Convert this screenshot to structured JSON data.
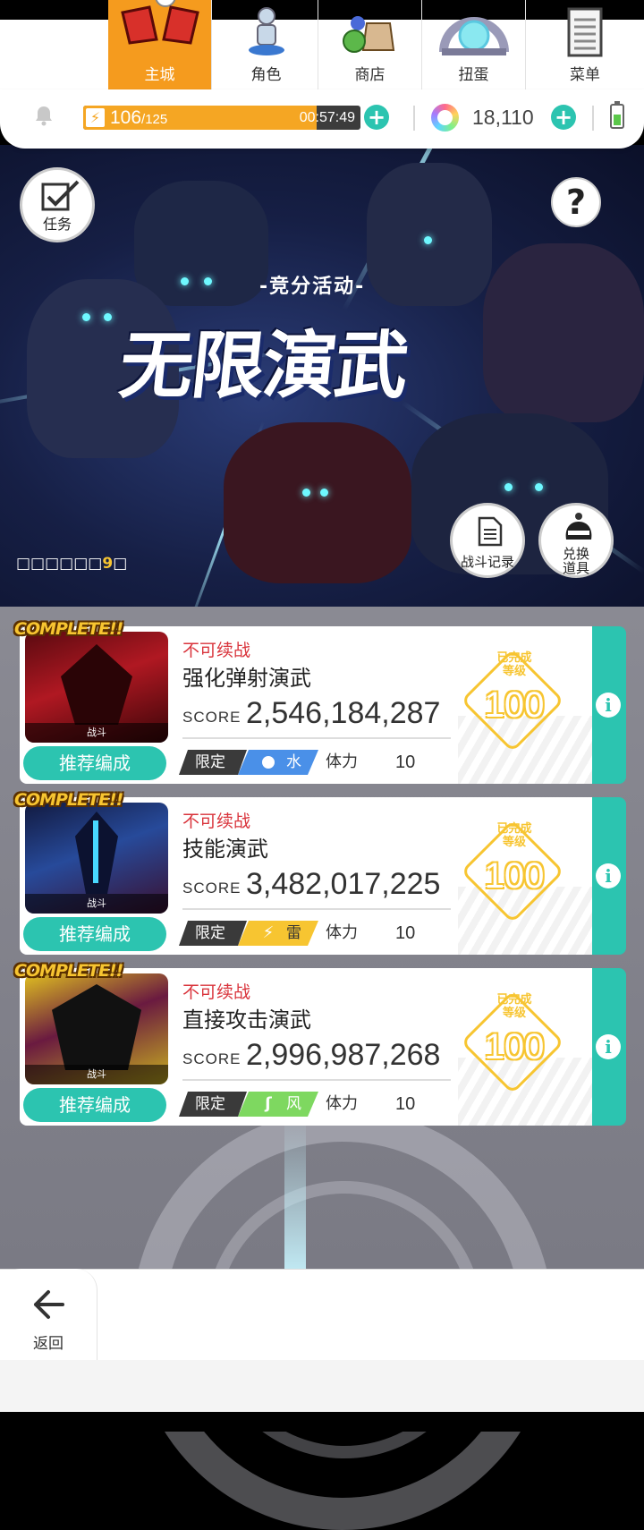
{
  "resources": {
    "stamina_current": "106",
    "stamina_max": "/125",
    "stamina_fraction": 0.843,
    "stamina_timer": "00:57:49",
    "gems": "18,110"
  },
  "event": {
    "tasks_label": "任务",
    "tag": "-竞分活动-",
    "title": "无限演武",
    "remain_prefix": "□□□□□□",
    "remain_number": "9",
    "remain_suffix": "□",
    "battle_log_label": "战斗记录",
    "exchange_label_1": "兑换",
    "exchange_label_2": "道具"
  },
  "cards": [
    {
      "complete": "COMPLETE!!",
      "thumb_label": "战斗",
      "status": "不可续战",
      "title": "强化弹射演武",
      "score_label": "SCORE",
      "score": "2,546,184,287",
      "recommend": "推荐编成",
      "limit": "限定",
      "element": "水",
      "element_color": "#4a90e8",
      "stamina_label": "体力",
      "stamina_cost": "10",
      "badge_top_1": "已完成",
      "badge_top_2": "等级",
      "level": "100"
    },
    {
      "complete": "COMPLETE!!",
      "thumb_label": "战斗",
      "status": "不可续战",
      "title": "技能演武",
      "score_label": "SCORE",
      "score": "3,482,017,225",
      "recommend": "推荐编成",
      "limit": "限定",
      "element": "雷",
      "element_color": "#f7c531",
      "stamina_label": "体力",
      "stamina_cost": "10",
      "badge_top_1": "已完成",
      "badge_top_2": "等级",
      "level": "100"
    },
    {
      "complete": "COMPLETE!!",
      "thumb_label": "战斗",
      "status": "不可续战",
      "title": "直接攻击演武",
      "score_label": "SCORE",
      "score": "2,996,987,268",
      "recommend": "推荐编成",
      "limit": "限定",
      "element": "风",
      "element_color": "#7ed860",
      "stamina_label": "体力",
      "stamina_cost": "10",
      "badge_top_1": "已完成",
      "badge_top_2": "等级",
      "level": "100"
    }
  ],
  "nav": {
    "back": "返回",
    "home": "主城",
    "characters": "角色",
    "shop": "商店",
    "gacha": "扭蛋",
    "menu": "菜单"
  },
  "colors": {
    "accent": "#2cc4b0",
    "stamina": "#f5a623",
    "active_tab": "#f59b1e",
    "status_red": "#d9343c",
    "gold": "#f7c531"
  }
}
